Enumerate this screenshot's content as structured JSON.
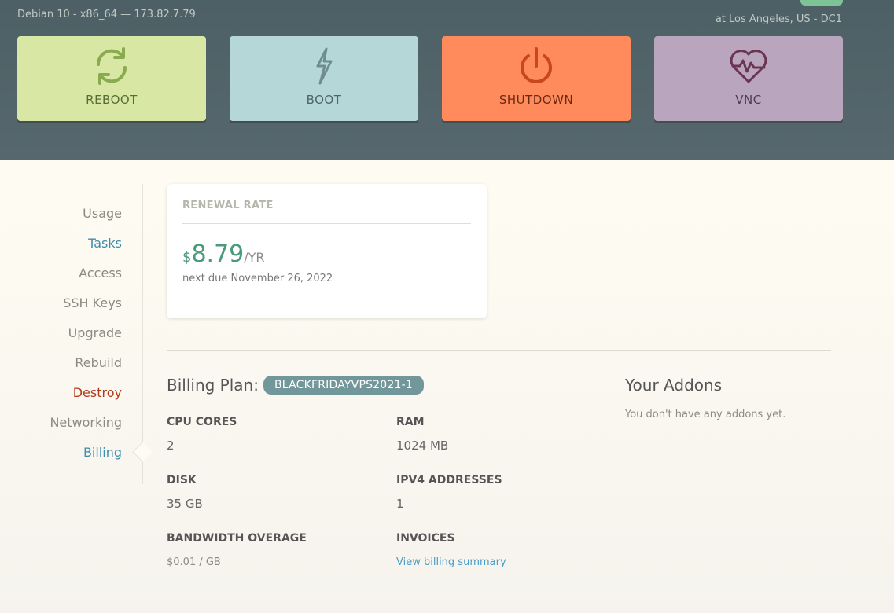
{
  "server": {
    "os_line": "Debian 10 - x86_64 — 173.82.7.79",
    "location": "at Los Angeles, US - DC1"
  },
  "actions": [
    {
      "label": "REBOOT",
      "icon": "refresh-icon"
    },
    {
      "label": "BOOT",
      "icon": "lightning-bolt-icon"
    },
    {
      "label": "SHUTDOWN",
      "icon": "power-icon"
    },
    {
      "label": "VNC",
      "icon": "heart-monitor-icon"
    }
  ],
  "colors": {
    "reboot": "#d8e8a4",
    "boot": "#b5d7d8",
    "shutdown": "#ff8b5c",
    "vnc": "#b9a5be",
    "accent_blue": "#3d8db0",
    "accent_red": "#b23a1b",
    "price_green": "#4c9a7c"
  },
  "nav": {
    "items": [
      {
        "label": "Usage"
      },
      {
        "label": "Tasks"
      },
      {
        "label": "Access"
      },
      {
        "label": "SSH Keys"
      },
      {
        "label": "Upgrade"
      },
      {
        "label": "Rebuild"
      },
      {
        "label": "Destroy"
      },
      {
        "label": "Networking"
      },
      {
        "label": "Billing"
      }
    ],
    "active": "Billing"
  },
  "renewal": {
    "title": "RENEWAL RATE",
    "currency": "$",
    "amount": "8.79",
    "period": "/YR",
    "next_due": "next due November 26, 2022"
  },
  "billing": {
    "plan_label": "Billing Plan:",
    "plan_name": "BLACKFRIDAYVPS2021-1",
    "specs": {
      "cpu": {
        "label": "CPU CORES",
        "value": "2"
      },
      "ram": {
        "label": "RAM",
        "value": "1024 MB"
      },
      "disk": {
        "label": "DISK",
        "value": "35 GB"
      },
      "ipv4": {
        "label": "IPV4 ADDRESSES",
        "value": "1"
      },
      "bandwidth": {
        "label": "BANDWIDTH OVERAGE",
        "value": "$0.01 / GB"
      },
      "invoices": {
        "label": "INVOICES",
        "link": "View billing summary"
      }
    }
  },
  "addons": {
    "title": "Your Addons",
    "empty": "You don't have any addons yet."
  }
}
